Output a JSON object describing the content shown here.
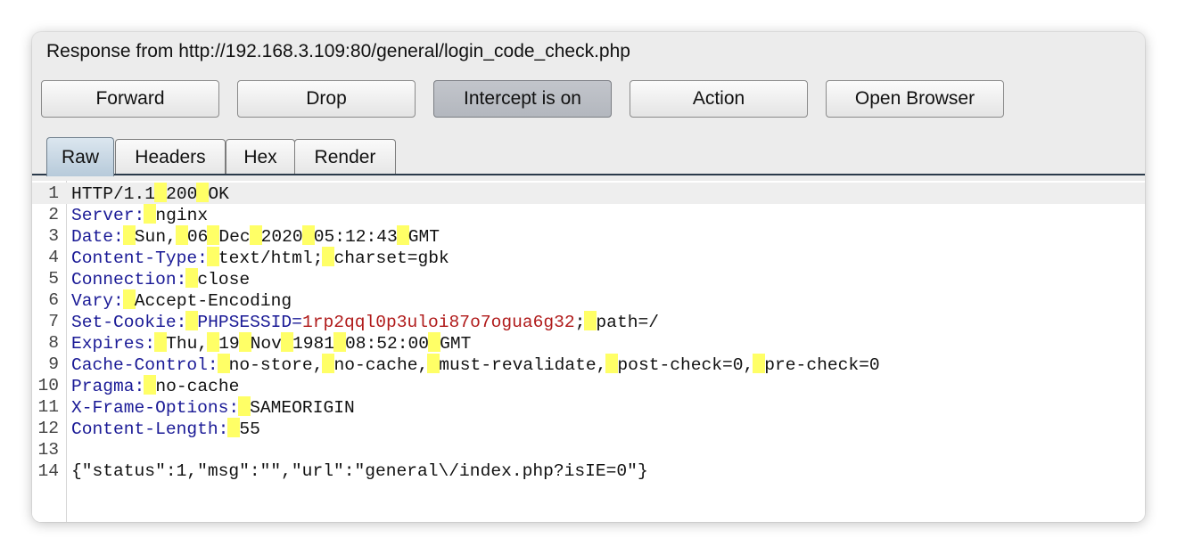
{
  "title": "Response from http://192.168.3.109:80/general/login_code_check.php",
  "buttons": {
    "forward": "Forward",
    "drop": "Drop",
    "intercept": "Intercept is on",
    "action": "Action",
    "open_browser": "Open Browser"
  },
  "tabs": [
    "Raw",
    "Headers",
    "Hex",
    "Render"
  ],
  "selected_tab": "Raw",
  "line_numbers": [
    "1",
    "2",
    "3",
    "4",
    "5",
    "6",
    "7",
    "8",
    "9",
    "10",
    "11",
    "12",
    "13",
    "14"
  ],
  "response": {
    "status_line": [
      "HTTP/1.1",
      "200",
      "OK"
    ],
    "headers": [
      {
        "name": "Server:",
        "parts": [
          "nginx"
        ]
      },
      {
        "name": "Date:",
        "parts": [
          "Sun,",
          "06",
          "Dec",
          "2020",
          "05:12:43",
          "GMT"
        ]
      },
      {
        "name": "Content-Type:",
        "parts": [
          "text/html;",
          "charset=gbk"
        ]
      },
      {
        "name": "Connection:",
        "parts": [
          "close"
        ]
      },
      {
        "name": "Vary:",
        "parts": [
          "Accept-Encoding"
        ]
      },
      {
        "name": "Set-Cookie:",
        "cookie_name": "PHPSESSID=",
        "cookie_value": "1rp2qql0p3uloi87o7ogua6g32",
        "after": ";",
        "rest": "path=/"
      },
      {
        "name": "Expires:",
        "parts": [
          "Thu,",
          "19",
          "Nov",
          "1981",
          "08:52:00",
          "GMT"
        ]
      },
      {
        "name": "Cache-Control:",
        "parts": [
          "no-store,",
          "no-cache,",
          "must-revalidate,",
          "post-check=0,",
          "pre-check=0"
        ]
      },
      {
        "name": "Pragma:",
        "parts": [
          "no-cache"
        ]
      },
      {
        "name": "X-Frame-Options:",
        "parts": [
          "SAMEORIGIN"
        ]
      },
      {
        "name": "Content-Length:",
        "parts": [
          "55"
        ]
      }
    ],
    "body": "{\"status\":1,\"msg\":\"\",\"url\":\"general\\/index.php?isIE=0\"}"
  },
  "colors": {
    "header_name": "#1a1a96",
    "cookie_value": "#b01a1a",
    "space_marker": "#ffff66",
    "active_button": "#b8bcc2",
    "selected_tab": "#c7d6e3"
  }
}
